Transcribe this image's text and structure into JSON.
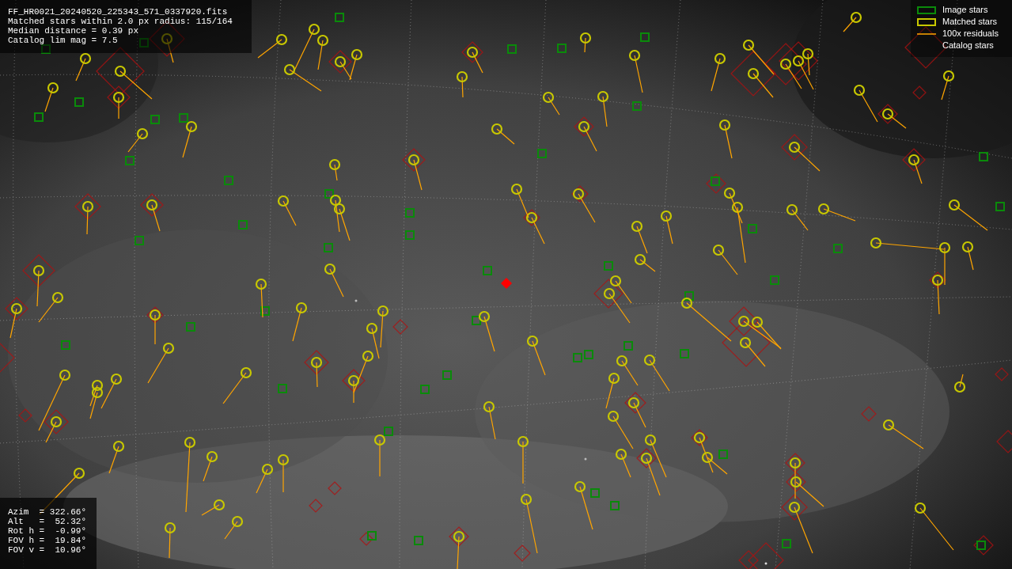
{
  "info_box": {
    "lines": [
      "FF_HR0021_20240520_225343_571_0337920.fits",
      "Matched stars within 2.0 px radius: 115/164",
      "Median distance = 0.39 px",
      "Catalog lim mag = 7.5"
    ]
  },
  "legend": [
    {
      "label": "Image stars"
    },
    {
      "kind": "matched",
      "label": "Matched stars"
    },
    {
      "kind": "residual",
      "label": "100x residuals"
    },
    {
      "kind": "catalog",
      "label": "Catalog stars"
    }
  ],
  "pointing_box": {
    "lines": [
      "Azim  = 322.66°",
      "Alt   =  52.32°",
      "Rot h =  -0.99°",
      "FOV h =  19.84°",
      "FOV v =  10.96°"
    ]
  }
}
